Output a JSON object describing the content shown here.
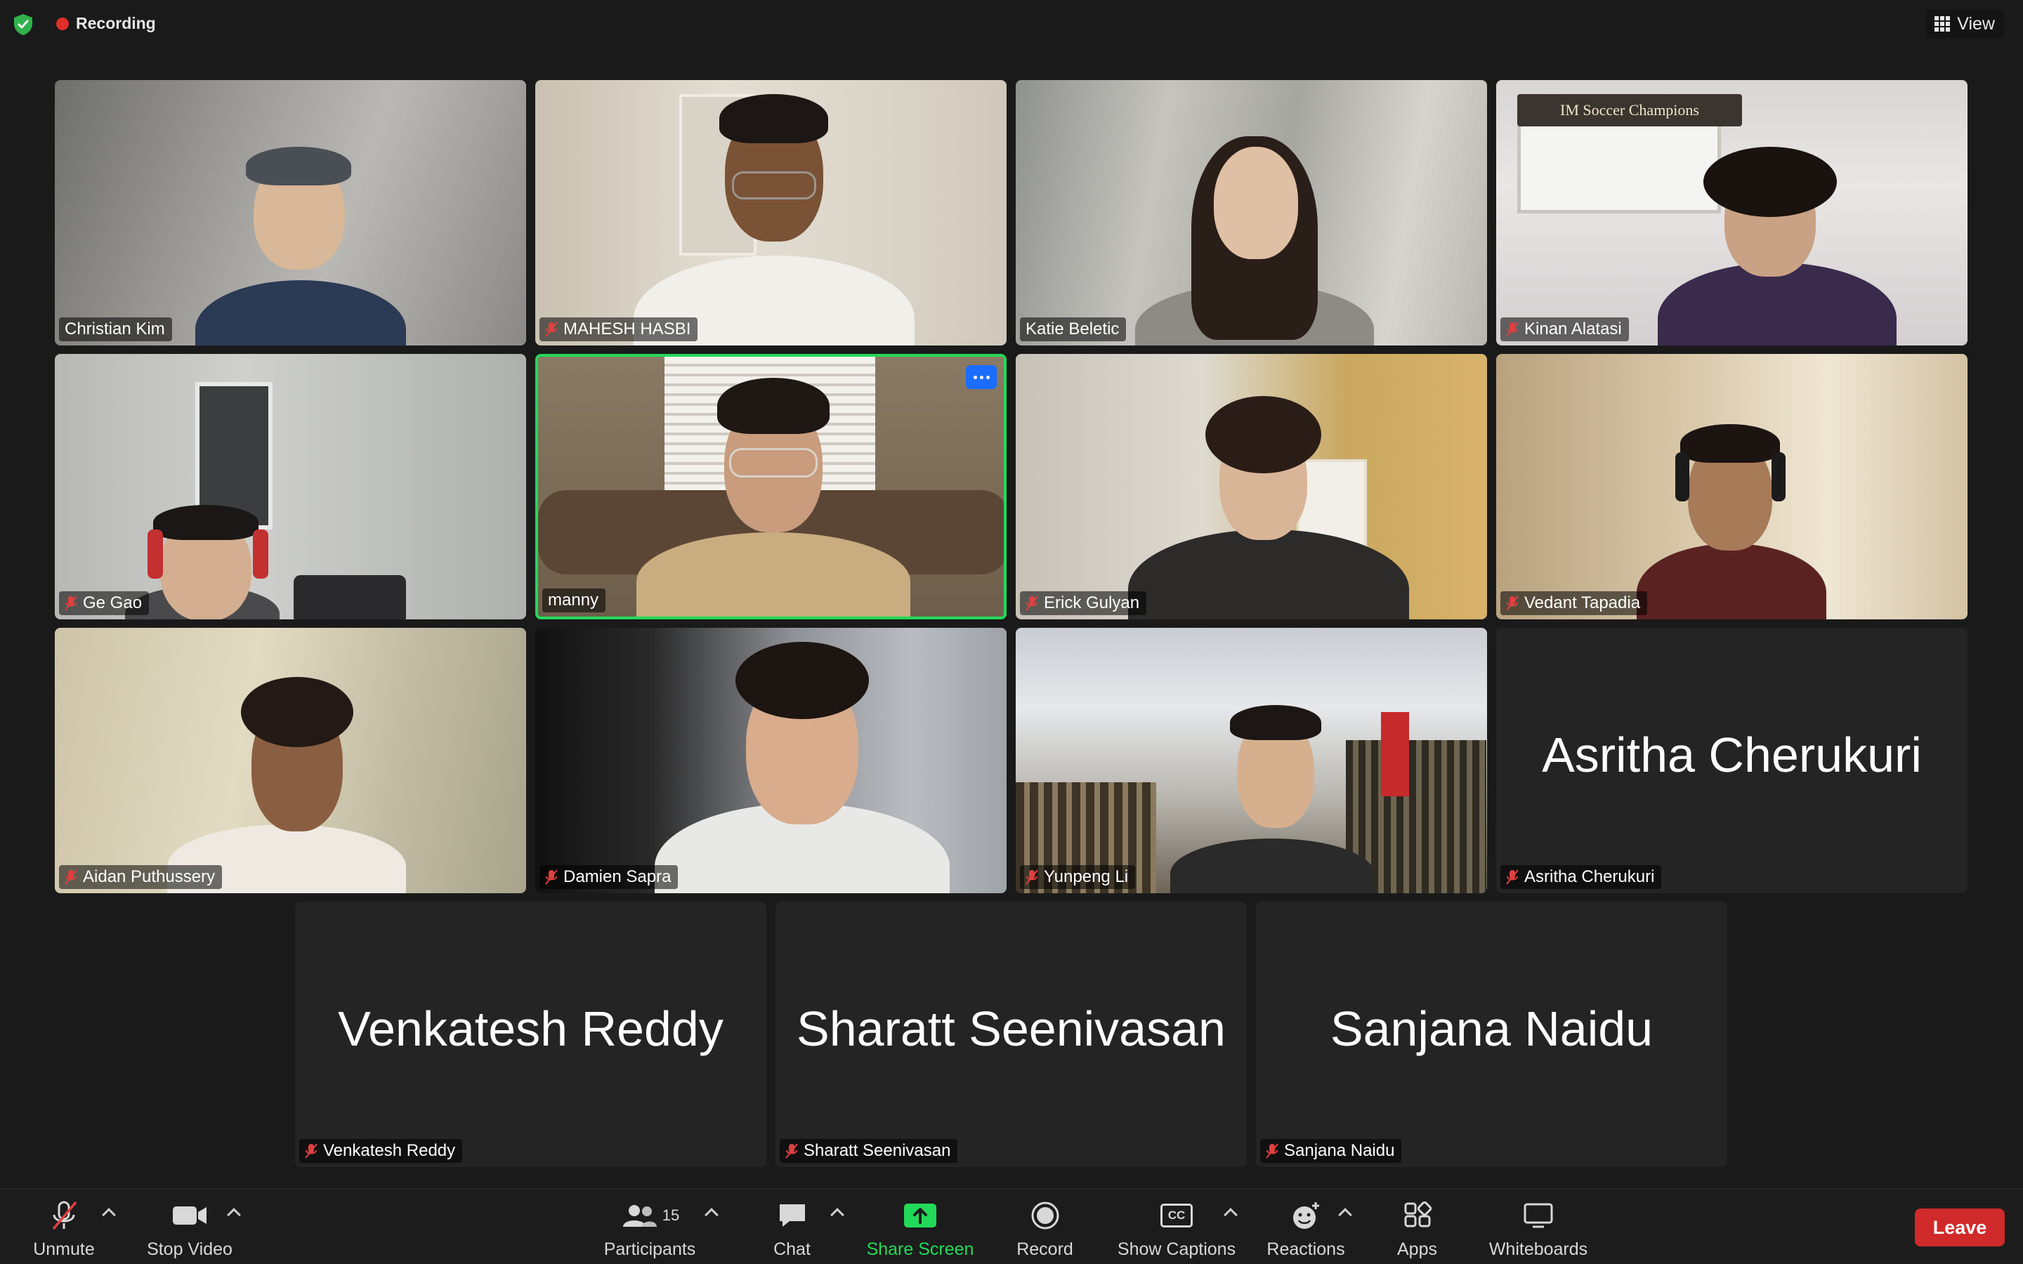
{
  "meeting": {
    "recording_label": "Recording",
    "view_label": "View"
  },
  "tiles": [
    {
      "name": "Christian Kim",
      "muted": false,
      "video": true
    },
    {
      "name": "MAHESH HASBI",
      "muted": true,
      "video": true
    },
    {
      "name": "Katie Beletic",
      "muted": false,
      "video": true
    },
    {
      "name": "Kinan Alatasi",
      "muted": true,
      "video": true,
      "banner": "IM Soccer Champions"
    },
    {
      "name": "Ge Gao",
      "muted": true,
      "video": true
    },
    {
      "name": "manny",
      "muted": false,
      "video": true,
      "active_speaker": true
    },
    {
      "name": "Erick Gulyan",
      "muted": true,
      "video": true
    },
    {
      "name": "Vedant Tapadia",
      "muted": true,
      "video": true
    },
    {
      "name": "Aidan Puthussery",
      "muted": true,
      "video": true
    },
    {
      "name": "Damien Sapra",
      "muted": true,
      "video": true
    },
    {
      "name": "Yunpeng Li",
      "muted": true,
      "video": true
    },
    {
      "name": "Asritha Cherukuri",
      "muted": true,
      "video": false
    },
    {
      "name": "Venkatesh Reddy",
      "muted": true,
      "video": false
    },
    {
      "name": "Sharatt Seenivasan",
      "muted": true,
      "video": false
    },
    {
      "name": "Sanjana Naidu",
      "muted": true,
      "video": false
    }
  ],
  "toolbar": {
    "unmute": "Unmute",
    "stop_video": "Stop Video",
    "participants": "Participants",
    "participants_count": "15",
    "chat": "Chat",
    "share_screen": "Share Screen",
    "record": "Record",
    "show_captions": "Show Captions",
    "captions_icon_text": "CC",
    "reactions": "Reactions",
    "apps": "Apps",
    "whiteboards": "Whiteboards",
    "leave": "Leave"
  },
  "colors": {
    "active_speaker_border": "#23d959",
    "share_screen_green": "#23d959",
    "leave_red": "#d12a2a",
    "recording_red": "#e02e2a",
    "more_button_blue": "#1a6dff",
    "tile_background": "#242424",
    "app_background": "#1a1a1a"
  }
}
